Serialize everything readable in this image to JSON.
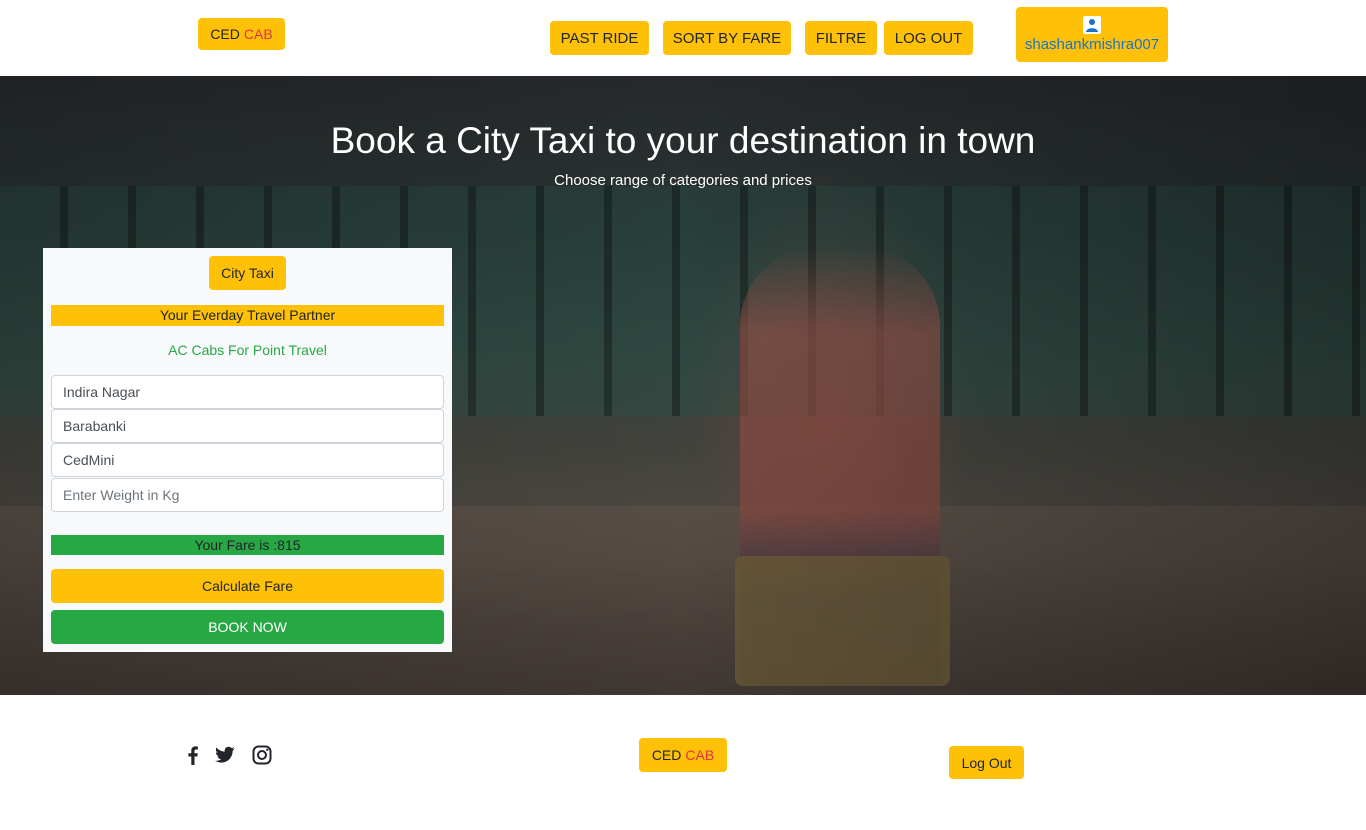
{
  "header": {
    "brand_main": "CED",
    "brand_accent": "CAB",
    "nav": {
      "past_ride": "PAST RIDE",
      "sort_by_fare": "SORT BY FARE",
      "filter": "FILTRE",
      "log_out": "LOG OUT"
    },
    "user": {
      "icon": "user-icon",
      "name": "shashankmishra007"
    }
  },
  "hero": {
    "title": "Book a City Taxi to your destination in town",
    "subtitle": "Choose range of categories and prices"
  },
  "booking": {
    "category_button": "City Taxi",
    "tagline": "Your Everday Travel Partner",
    "subtagline": "AC Cabs For Point Travel",
    "pickup_value": "Indira Nagar",
    "drop_value": "Barabanki",
    "cab_type_value": "CedMini",
    "weight_placeholder": "Enter Weight in Kg",
    "fare_text": "Your Fare is :815",
    "calculate_label": "Calculate Fare",
    "book_label": "BOOK NOW"
  },
  "footer": {
    "social_icons": [
      "facebook-icon",
      "twitter-icon",
      "instagram-icon"
    ],
    "brand_main": "CED",
    "brand_accent": "CAB",
    "logout_label": "Log Out"
  },
  "colors": {
    "accent_yellow": "#ffc107",
    "success_green": "#28a745",
    "brand_red": "#dc3545",
    "user_link_blue": "#1a73c9"
  }
}
